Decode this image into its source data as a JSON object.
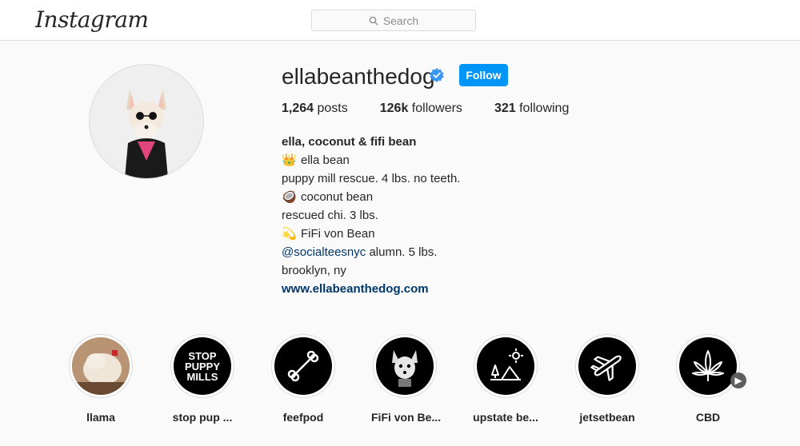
{
  "header": {
    "logo": "Instagram",
    "search": {
      "placeholder": "Search",
      "icon": "search-icon"
    }
  },
  "profile": {
    "username": "ellabeanthedog",
    "verified": true,
    "follow_label": "Follow",
    "stats": {
      "posts_count": "1,264",
      "posts_label": "posts",
      "followers_count": "126k",
      "followers_label": "followers",
      "following_count": "321",
      "following_label": "following"
    },
    "bio": {
      "name": "ella, coconut & fifi bean",
      "line1_emoji": "👑",
      "line1": "ella bean",
      "line2": "puppy mill rescue. 4 lbs. no teeth.",
      "line3_emoji": "🥥",
      "line3": "coconut bean",
      "line4": "rescued chi. 3 lbs.",
      "line5_emoji": "💫",
      "line5": "FiFi von Bean",
      "mention": "@socialteesnyc",
      "line6_rest": " alumn. 5 lbs.",
      "line7": "brooklyn, ny",
      "website": "www.ellabeanthedog.com"
    }
  },
  "highlights": [
    {
      "label": "llama"
    },
    {
      "label": "stop pup ...",
      "cover_text": [
        "STOP",
        "PUPPY",
        "MILLS"
      ]
    },
    {
      "label": "feefpod"
    },
    {
      "label": "FiFi von Be..."
    },
    {
      "label": "upstate be..."
    },
    {
      "label": "jetsetbean"
    },
    {
      "label": "CBD"
    }
  ],
  "colors": {
    "follow_button": "#0095f6",
    "link": "#00376b",
    "verified": "#3897f0"
  }
}
